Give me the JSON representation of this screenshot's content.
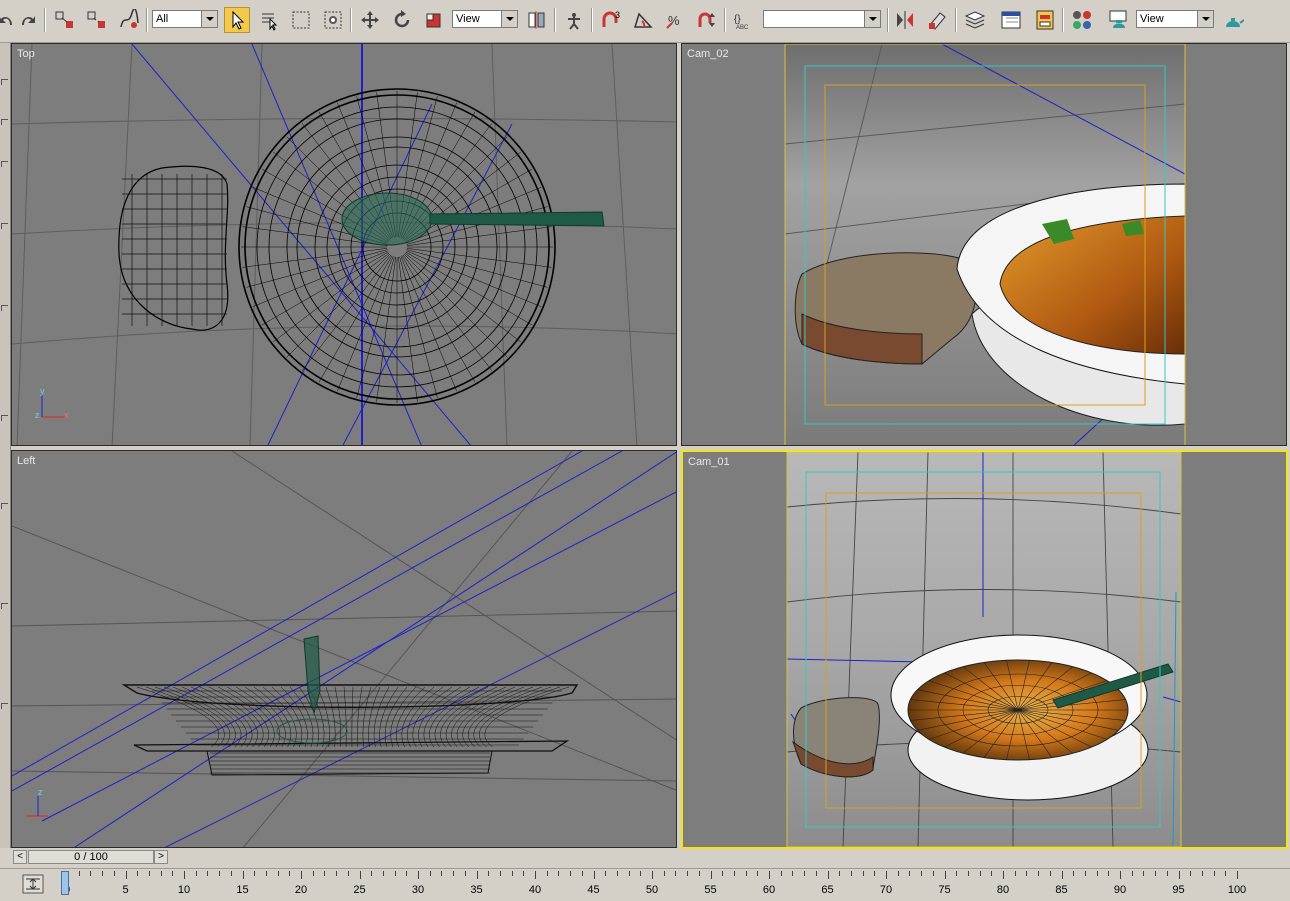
{
  "toolbar": {
    "selection_filter": "All",
    "ref_coord_system": "View",
    "named_selection": "",
    "ref_coord_system_2": "View",
    "icons": [
      "undo-icon",
      "redo-icon",
      "select-and-link-icon",
      "unlink-icon",
      "bind-space-warp-icon",
      "select-object-icon",
      "select-by-name-icon",
      "rectangle-selection-icon",
      "window-crossing-icon",
      "move-icon",
      "rotate-icon",
      "scale-icon",
      "pivot-icon",
      "manipulate-icon",
      "snaps-toggle-icon",
      "angle-snap-icon",
      "percent-snap-icon",
      "spinner-snap-icon",
      "edit-named-selection-icon",
      "mirror-icon",
      "align-icon",
      "layer-manager-icon",
      "curve-editor-icon",
      "schematic-view-icon",
      "material-editor-icon",
      "render-scene-icon",
      "quick-render-icon"
    ]
  },
  "viewports": {
    "top_left": {
      "label": "Top"
    },
    "top_right": {
      "label": "Cam_02"
    },
    "bottom_left": {
      "label": "Left"
    },
    "bottom_right": {
      "label": "Cam_01"
    }
  },
  "axis": {
    "x": "x",
    "y": "y",
    "z": "z"
  },
  "time": {
    "current": "0 / 100",
    "prev": "<",
    "next": ">",
    "ruler_labels": [
      "0",
      "5",
      "10",
      "15",
      "20",
      "25",
      "30",
      "35",
      "40",
      "45",
      "50",
      "55",
      "60",
      "65",
      "70",
      "75",
      "80",
      "85",
      "90",
      "95",
      "100"
    ]
  },
  "colors": {
    "viewport_bg": "#7d7d7d",
    "active_border": "#f5e312",
    "safe_frame_outer": "#d8c23a",
    "safe_frame_action": "#33c8c8",
    "safe_frame_title": "#d8a020",
    "camera_lines": "#2020c8",
    "spoon": "#1f5a46"
  }
}
